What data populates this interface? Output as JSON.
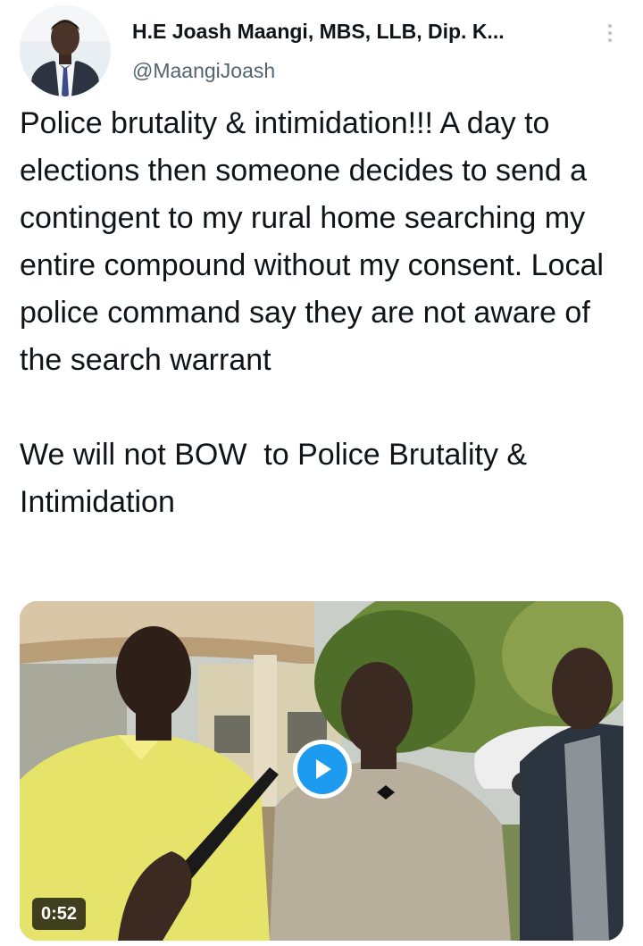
{
  "author": {
    "display_name": "H.E Joash Maangi, MBS, LLB, Dip. K...",
    "handle": "@MaangiJoash"
  },
  "tweet": {
    "paragraph_1": "Police brutality & intimidation!!! A day to elections then someone decides to send a contingent to my rural home searching my entire compound without my consent. Local police command say they are not aware of the search warrant",
    "paragraph_2": "We will not BOW  to Police Brutality & Intimidation"
  },
  "media": {
    "type": "video",
    "duration": "0:52"
  },
  "colors": {
    "accent": "#1d9bf0",
    "text_primary": "#0f1419",
    "text_secondary": "#536471"
  },
  "icons": {
    "more": "more-vertical-icon",
    "play": "play-icon"
  }
}
